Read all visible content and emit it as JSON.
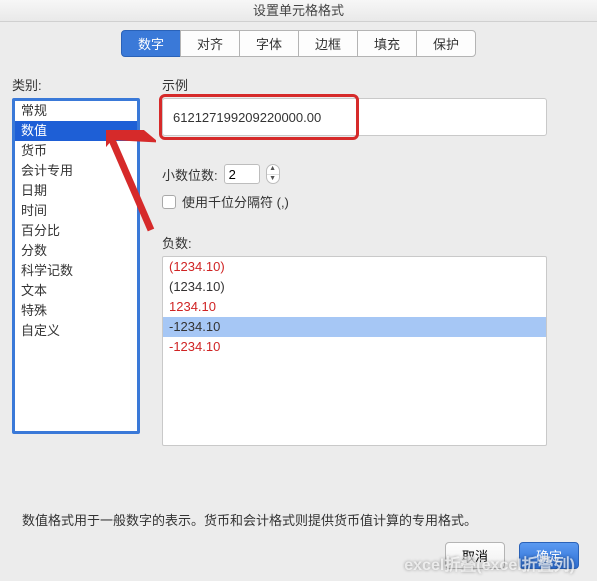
{
  "title": "设置单元格格式",
  "tabs": [
    {
      "label": "数字",
      "active": true
    },
    {
      "label": "对齐",
      "active": false
    },
    {
      "label": "字体",
      "active": false
    },
    {
      "label": "边框",
      "active": false
    },
    {
      "label": "填充",
      "active": false
    },
    {
      "label": "保护",
      "active": false
    }
  ],
  "category_label": "类别:",
  "categories": [
    {
      "label": "常规",
      "selected": false
    },
    {
      "label": "数值",
      "selected": true
    },
    {
      "label": "货币",
      "selected": false
    },
    {
      "label": "会计专用",
      "selected": false
    },
    {
      "label": "日期",
      "selected": false
    },
    {
      "label": "时间",
      "selected": false
    },
    {
      "label": "百分比",
      "selected": false
    },
    {
      "label": "分数",
      "selected": false
    },
    {
      "label": "科学记数",
      "selected": false
    },
    {
      "label": "文本",
      "selected": false
    },
    {
      "label": "特殊",
      "selected": false
    },
    {
      "label": "自定义",
      "selected": false
    }
  ],
  "sample_label": "示例",
  "sample_value": "612127199209220000.00",
  "decimal_label": "小数位数:",
  "decimal_value": "2",
  "thousands_label": "使用千位分隔符 (,)",
  "negative_label": "负数:",
  "negative_formats": [
    {
      "text": "(1234.10)",
      "color": "#d02424",
      "selected": false
    },
    {
      "text": "(1234.10)",
      "color": "#333333",
      "selected": false
    },
    {
      "text": "1234.10",
      "color": "#d02424",
      "selected": false
    },
    {
      "text": "-1234.10",
      "color": "#333333",
      "selected": true
    },
    {
      "text": "-1234.10",
      "color": "#d02424",
      "selected": false
    }
  ],
  "help_text": "数值格式用于一般数字的表示。货币和会计格式则提供货币值计算的专用格式。",
  "cancel_label": "取消",
  "ok_label": "确定",
  "watermark": "excel折叠(excel折叠列)",
  "colors": {
    "highlight_red": "#d62a2a",
    "highlight_blue": "#3a79d8",
    "selected_row": "#a6c7f5"
  }
}
